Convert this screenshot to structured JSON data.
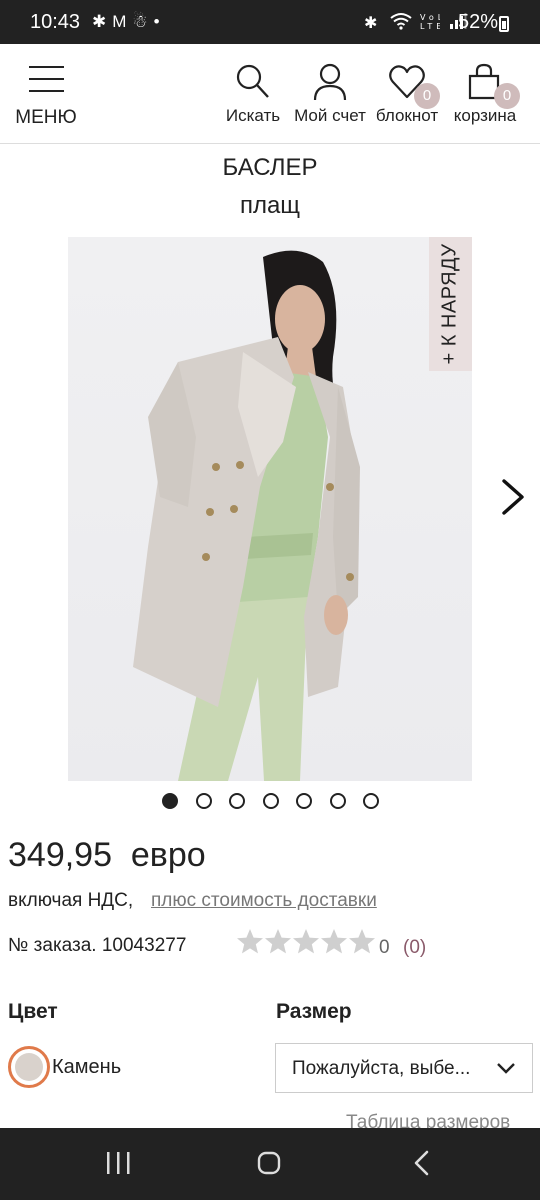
{
  "status_bar": {
    "time": "10:43",
    "left_icons": [
      "bluetooth-icon",
      "gmail-icon",
      "app-icon",
      "dot-icon"
    ],
    "right_icons": [
      "bluetooth-icon",
      "wifi-icon",
      "volte-lte-icon",
      "signal-icon"
    ],
    "battery": "52%"
  },
  "header": {
    "menu_label": "МЕНЮ",
    "search_label": "Искать",
    "account_label": "Мой счет",
    "notebook_label": "блокнот",
    "notebook_count": "0",
    "cart_label": "корзина",
    "cart_count": "0"
  },
  "product": {
    "brand": "БАСЛЕР",
    "name": "плащ",
    "outfit_tab": "+ К НАРЯДУ",
    "image_count": 7,
    "active_image": 1,
    "price": "349,95  евро",
    "vat_text": "включая НДС,",
    "shipping_link": "плюс стоимость доставки",
    "order_number": "№ заказа. 10043277",
    "rating": 0,
    "rating_max": 5,
    "rating_value": "0",
    "review_count": "(0)"
  },
  "options": {
    "color_heading": "Цвет",
    "color_name": "Камень",
    "size_heading": "Размер",
    "size_placeholder": "Пожалуйста, выбе...",
    "size_table_link": "Таблица размеров"
  },
  "colors": {
    "status_bar_bg": "#222222",
    "badge": "#cfbbbb",
    "swatch_ring": "#e07a4a",
    "swatch_fill": "#d9d2cc",
    "outfit_tab_bg": "#e9dfdf"
  },
  "nav_bar": {
    "icons": [
      "recent-apps-icon",
      "home-icon",
      "back-icon"
    ]
  }
}
